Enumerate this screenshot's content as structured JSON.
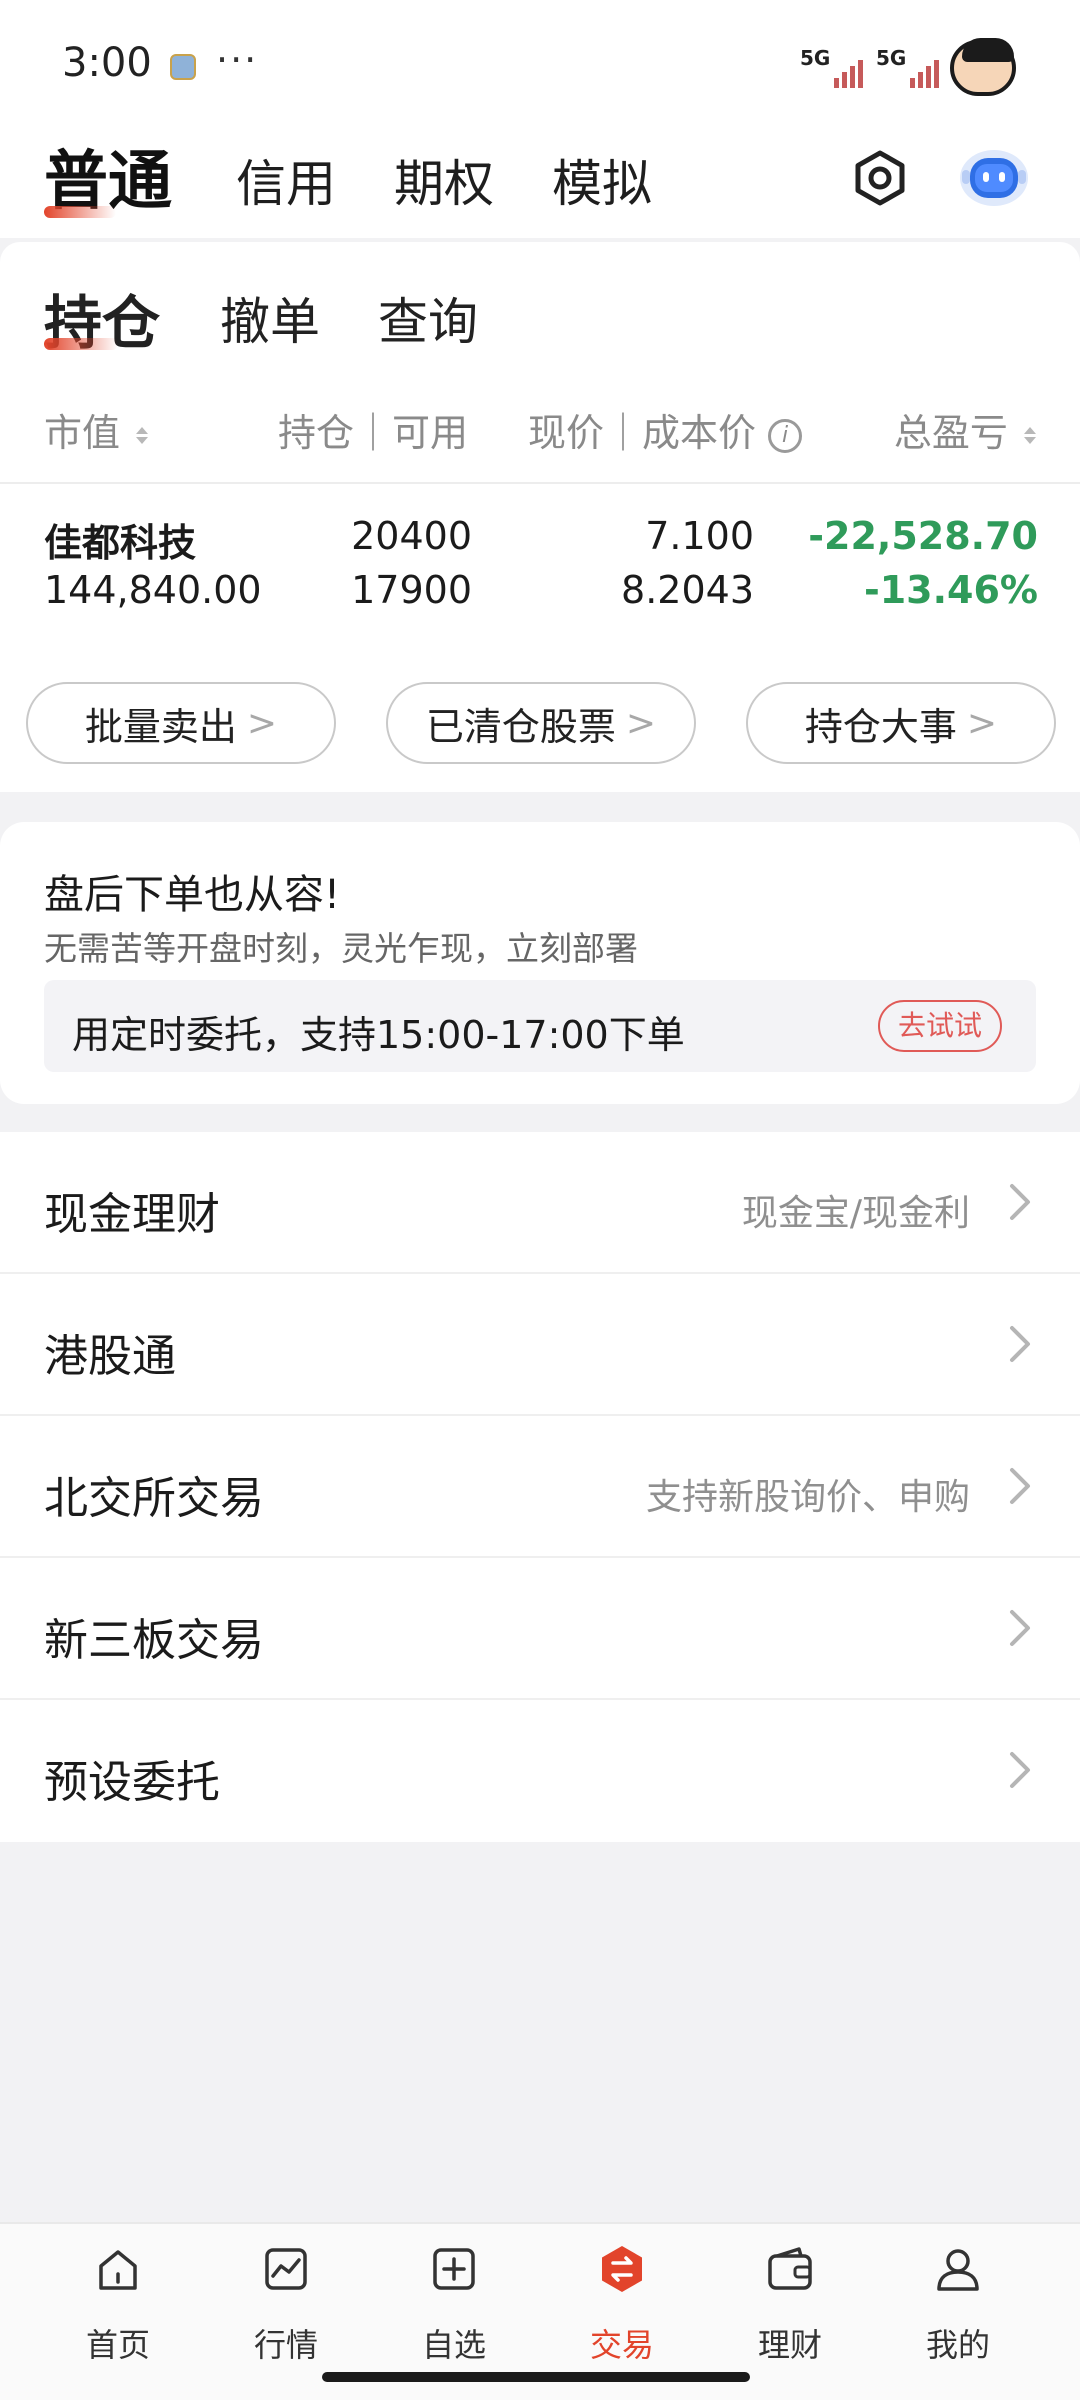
{
  "status_bar": {
    "time": "3:00",
    "more": "···",
    "network1": "5G",
    "network2": "5G"
  },
  "account_tabs": [
    {
      "label": "普通",
      "active": true
    },
    {
      "label": "信用",
      "active": false
    },
    {
      "label": "期权",
      "active": false
    },
    {
      "label": "模拟",
      "active": false
    }
  ],
  "sub_tabs": [
    {
      "label": "持仓",
      "active": true
    },
    {
      "label": "撤单",
      "active": false
    },
    {
      "label": "查询",
      "active": false
    }
  ],
  "table_headers": {
    "market_value": "市值",
    "position_available": "持仓｜可用",
    "price_cost": "现价｜成本价",
    "total_pnl": "总盈亏"
  },
  "holdings": [
    {
      "name": "佳都科技",
      "market_value": "144,840.00",
      "position": "20400",
      "available": "17900",
      "price": "7.100",
      "cost": "8.2043",
      "pnl": "-22,528.70",
      "pnl_pct": "-13.46%"
    }
  ],
  "action_pills": [
    {
      "label": "批量卖出"
    },
    {
      "label": "已清仓股票"
    },
    {
      "label": "持仓大事"
    }
  ],
  "promo": {
    "title": "盘后下单也从容!",
    "subtitle": "无需苦等开盘时刻，灵光乍现，立刻部署",
    "box_text": "用定时委托，支持15:00-17:00下单",
    "button": "去试试"
  },
  "menu_items": [
    {
      "label": "现金理财",
      "hint": "现金宝/现金利"
    },
    {
      "label": "港股通",
      "hint": ""
    },
    {
      "label": "北交所交易",
      "hint": "支持新股询价、申购"
    },
    {
      "label": "新三板交易",
      "hint": ""
    },
    {
      "label": "预设委托",
      "hint": ""
    }
  ],
  "bottom_nav": [
    {
      "label": "首页",
      "icon": "home-icon",
      "active": false
    },
    {
      "label": "行情",
      "icon": "chart-icon",
      "active": false
    },
    {
      "label": "自选",
      "icon": "add-square-icon",
      "active": false
    },
    {
      "label": "交易",
      "icon": "trade-exchange-icon",
      "active": true
    },
    {
      "label": "理财",
      "icon": "wallet-icon",
      "active": false
    },
    {
      "label": "我的",
      "icon": "user-icon",
      "active": false
    }
  ],
  "colors": {
    "accent": "#e2442b",
    "loss_green": "#2f9b5a",
    "try_button": "#e05a57"
  }
}
